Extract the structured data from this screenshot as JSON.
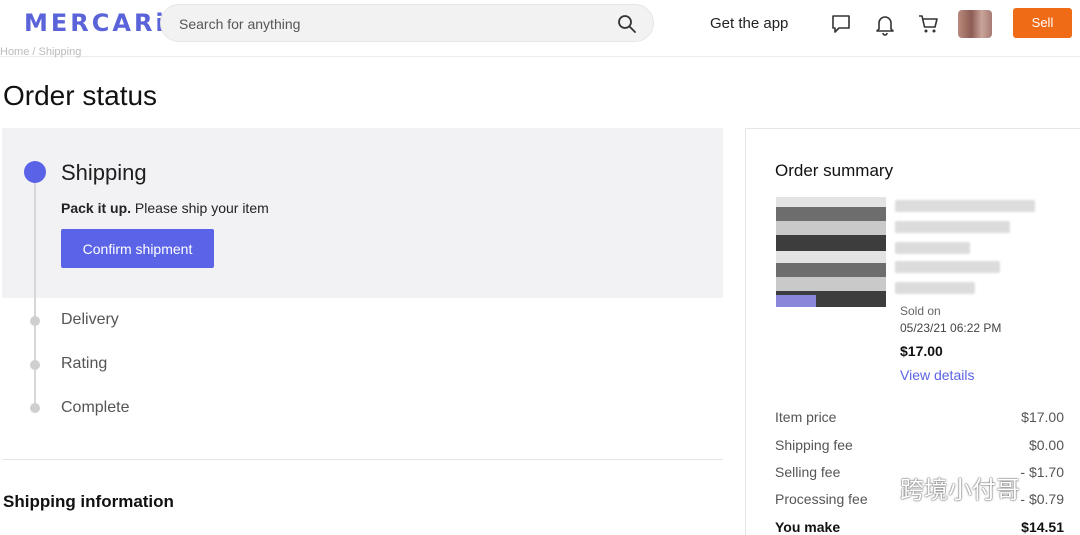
{
  "header": {
    "logo": "MERCARi",
    "search_placeholder": "Search for anything",
    "get_app": "Get the app",
    "sell": "Sell"
  },
  "breadcrumb": "Home / Shipping",
  "page_title": "Order status",
  "steps": {
    "current": {
      "title": "Shipping",
      "desc_bold": "Pack it up.",
      "desc_rest": " Please ship your item",
      "button": "Confirm shipment"
    },
    "upcoming": [
      "Delivery",
      "Rating",
      "Complete"
    ]
  },
  "shipping_info_title": "Shipping information",
  "summary": {
    "title": "Order summary",
    "sold_on_label": "Sold on",
    "sold_date": "05/23/21 06:22 PM",
    "sold_price": "$17.00",
    "view_details": "View details",
    "rows": [
      {
        "label": "Item price",
        "value": "$17.00"
      },
      {
        "label": "Shipping fee",
        "value": "$0.00"
      },
      {
        "label": "Selling fee",
        "value": "- $1.70"
      },
      {
        "label": "Processing fee",
        "value": "- $0.79"
      },
      {
        "label": "You make",
        "value": "$14.51"
      }
    ]
  },
  "watermark": "跨境小付哥",
  "colors": {
    "brand": "#5a63d8",
    "sell": "#f06b15",
    "accent": "#5b63e6"
  },
  "icons": {
    "search": "search-icon",
    "messages": "chat-icon",
    "notifications": "bell-icon",
    "cart": "cart-icon"
  }
}
